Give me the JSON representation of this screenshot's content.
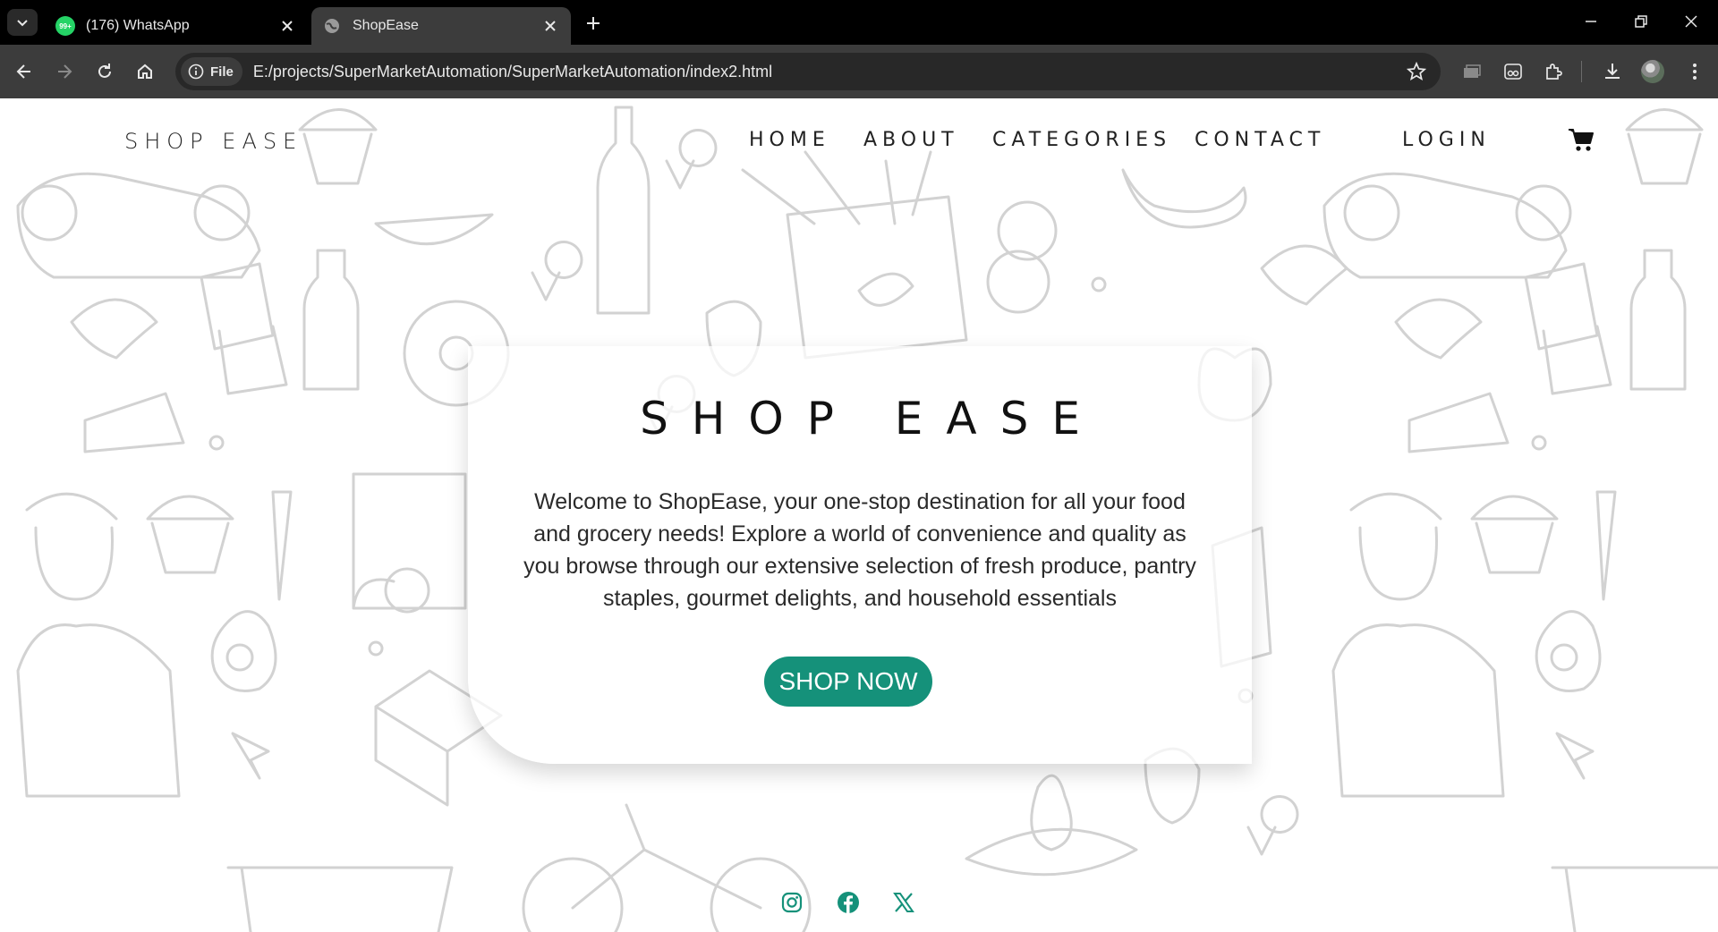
{
  "browser": {
    "tabs": [
      {
        "title": "(176) WhatsApp",
        "badge": "99+",
        "active": false
      },
      {
        "title": "ShopEase",
        "active": true
      }
    ],
    "address": {
      "chip_label": "File",
      "url": "E:/projects/SuperMarketAutomation/SuperMarketAutomation/index2.html"
    },
    "icons": [
      "tab-search-icon",
      "close-icon",
      "new-tab-icon",
      "minimize-icon",
      "restore-icon",
      "window-close-icon",
      "back-icon",
      "forward-icon",
      "reload-icon",
      "home-icon",
      "info-icon",
      "bookmark-star-icon",
      "media-icon",
      "reading-mode-icon",
      "extensions-icon",
      "download-icon",
      "profile-avatar",
      "menu-icon"
    ]
  },
  "site": {
    "brand": "SHOP EASE",
    "nav": [
      "HOME",
      "ABOUT",
      "CATEGORIES",
      "CONTACT"
    ],
    "login": "LOGIN",
    "hero": {
      "title": "SHOP EASE",
      "text": "Welcome to ShopEase, your one-stop destination for all your food and grocery needs! Explore a world of convenience and quality as you browse through our extensive selection of fresh produce, pantry staples, gourmet delights, and household essentials",
      "button": "SHOP NOW"
    },
    "social": [
      "instagram-icon",
      "facebook-icon",
      "x-icon"
    ],
    "colors": {
      "accent": "#15917a",
      "text": "#222222",
      "doodle": "#d2d2d2"
    }
  }
}
